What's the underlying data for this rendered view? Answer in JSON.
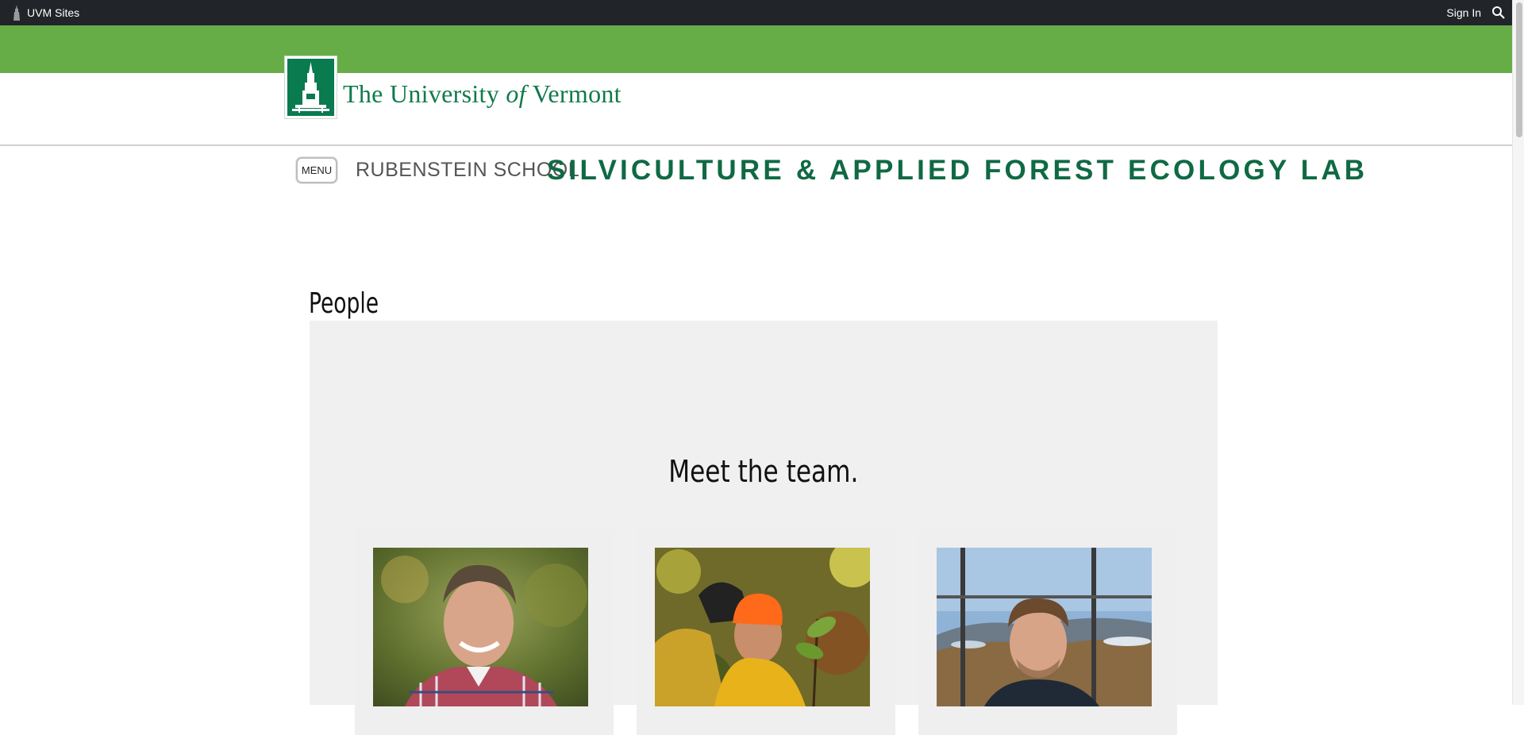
{
  "topbar": {
    "sites_label": "UVM Sites",
    "signin_label": "Sign In",
    "search_icon": "search-icon",
    "logo_icon": "uvm-tower-icon"
  },
  "header": {
    "university_name_1": "The University ",
    "university_name_of": "of",
    "university_name_2": " Vermont",
    "menu_label": "MENU",
    "school_label": "RUBENSTEIN SCHOOL",
    "lab_label": "SILVICULTURE & APPLIED FOREST ECOLOGY LAB"
  },
  "main": {
    "page_title": "People",
    "team_heading": "Meet the team.",
    "cards": [
      {
        "photo": "portrait-man-plaid-shirt"
      },
      {
        "photo": "portrait-man-orange-hat-forest"
      },
      {
        "photo": "portrait-man-fire-tower-view"
      }
    ]
  },
  "colors": {
    "topbar": "#212529",
    "green_bar": "#67ad47",
    "brand_green": "#0f6a44",
    "panel": "#f0f0f0"
  }
}
